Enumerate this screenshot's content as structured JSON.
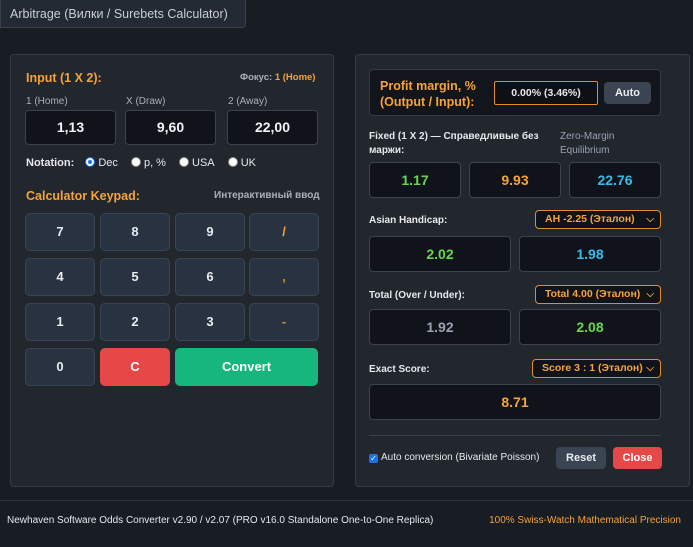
{
  "tab": {
    "title": "Arbitrage (Вилки / Surebets Calculator)"
  },
  "input": {
    "title": "Input (1 X 2):",
    "focus_label": "Фокус:",
    "focus_value": "1 (Home)",
    "labels": [
      "1 (Home)",
      "X (Draw)",
      "2 (Away)"
    ],
    "values": [
      "1,13",
      "9,60",
      "22,00"
    ]
  },
  "notation": {
    "label": "Notation:",
    "options": [
      "Dec",
      "p, %",
      "USA",
      "UK"
    ],
    "selected": "Dec"
  },
  "keypad": {
    "title": "Calculator Keypad:",
    "subtitle": "Интерактивный ввод",
    "rows": [
      [
        "7",
        "8",
        "9",
        "/"
      ],
      [
        "4",
        "5",
        "6",
        ","
      ],
      [
        "1",
        "2",
        "3",
        "-"
      ]
    ],
    "zero": "0",
    "clear": "C",
    "convert": "Convert"
  },
  "profit": {
    "title_line1": "Profit margin, %",
    "title_line2": "(Output / Input):",
    "value": "0.00% (3.46%)",
    "auto": "Auto"
  },
  "fixed": {
    "title": "Fixed (1 X 2) — Справедливые без маржи:",
    "zero_margin_line1": "Zero-Margin",
    "zero_margin_line2": "Equilibrium",
    "values": [
      "1.17",
      "9.93",
      "22.76"
    ]
  },
  "asian": {
    "label": "Asian Handicap:",
    "selected": "AH -2.25 (Эталон)",
    "values": [
      "2.02",
      "1.98"
    ]
  },
  "total": {
    "label": "Total (Over / Under):",
    "selected": "Total 4.00 (Эталон)",
    "values": [
      "1.92",
      "2.08"
    ]
  },
  "exact": {
    "label": "Exact Score:",
    "selected": "Score 3 : 1 (Эталон)",
    "value": "8.71"
  },
  "bottom": {
    "auto_conversion": "Auto conversion (Bivariate Poisson)",
    "reset": "Reset",
    "close": "Close"
  },
  "footer": {
    "left": "Newhaven Software Odds Converter v2.90 / v2.07 (PRO v16.0 Standalone One-to-One Replica)",
    "right": "100% Swiss-Watch Mathematical Precision"
  },
  "colors": {
    "accent": "#f5a33a",
    "green": "#6ad64f",
    "cyan": "#36bdf0",
    "convert": "#17b67c",
    "clear": "#e64848"
  }
}
